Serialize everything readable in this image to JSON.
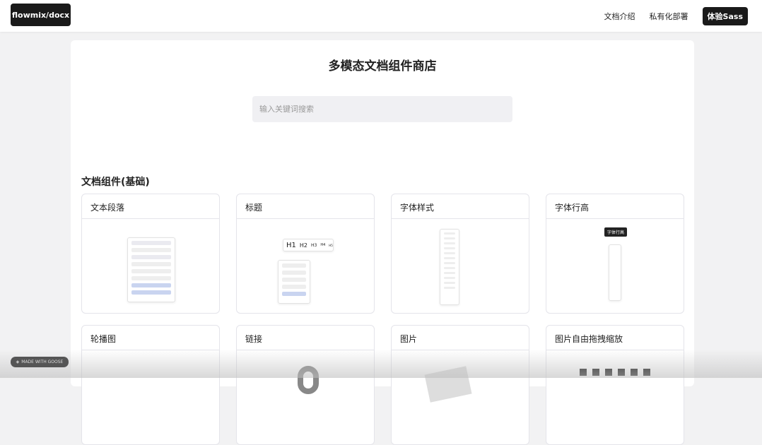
{
  "header": {
    "logo": "flowmix/docx",
    "nav": [
      "文档介绍",
      "私有化部署"
    ],
    "cta": "体验Sass"
  },
  "main": {
    "title": "多模态文档组件商店",
    "search_placeholder": "输入关键词搜索",
    "section_title": "文档组件(基础)",
    "cards": [
      {
        "label": "文本段落"
      },
      {
        "label": "标题"
      },
      {
        "label": "字体样式"
      },
      {
        "label": "字体行高"
      },
      {
        "label": "轮播图"
      },
      {
        "label": "链接"
      },
      {
        "label": "图片"
      },
      {
        "label": "图片自由拖拽缩放"
      }
    ],
    "heading_preview": [
      "H1",
      "H2",
      "H3",
      "H4",
      "H5"
    ],
    "lineheight_tooltip": "字体行高"
  },
  "badge": "MADE WITH GOOSE"
}
